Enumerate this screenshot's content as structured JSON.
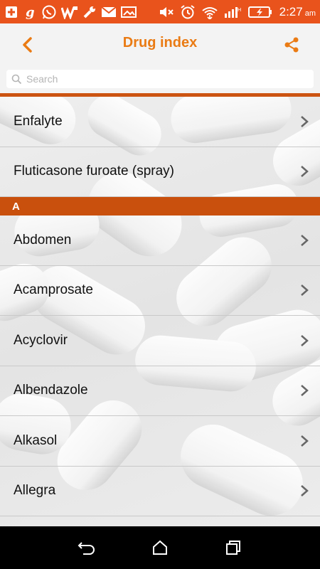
{
  "status_bar": {
    "time": "2:27",
    "ampm": "am",
    "icons": [
      "add-icon",
      "g-icon",
      "whatsapp-icon",
      "w-icon",
      "wrench-icon",
      "gmail-icon",
      "image-icon",
      "mute-icon",
      "alarm-icon",
      "wifi-icon",
      "signal-icon",
      "battery-charging-icon"
    ]
  },
  "header": {
    "title": "Drug index",
    "back_icon": "chevron-left-icon",
    "share_icon": "share-icon"
  },
  "search": {
    "placeholder": "Search"
  },
  "list": {
    "top_items": [
      "Enfalyte",
      "Fluticasone furoate (spray)"
    ],
    "section_a": {
      "letter": "A",
      "items": [
        "Abdomen",
        "Acamprosate",
        "Acyclovir",
        "Albendazole",
        "Alkasol",
        "Allegra"
      ]
    }
  },
  "nav_bar": {
    "icons": [
      "back-nav-icon",
      "home-nav-icon",
      "recents-nav-icon"
    ]
  },
  "colors": {
    "accent": "#ea7b14",
    "section": "#c9500d",
    "status_bar": "#e9531c"
  }
}
